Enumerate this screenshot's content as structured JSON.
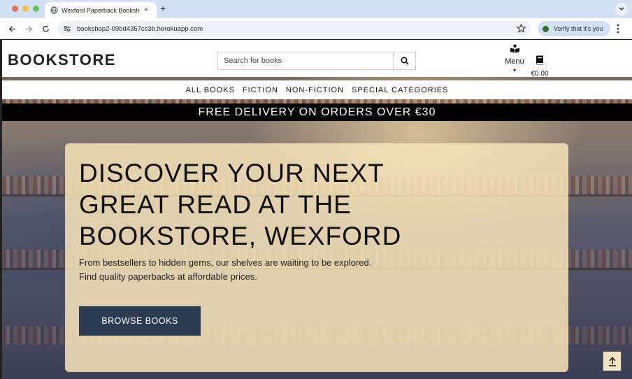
{
  "browser": {
    "tab_title": "Wexford Paperback Bookshop",
    "tab_close": "×",
    "new_tab": "+",
    "url": "bookshop2-09bd4357cc3b.herokuapp.com",
    "verify_label": "Verify that it's you",
    "icons": [
      "globe-icon",
      "back-icon",
      "forward-icon",
      "reload-icon",
      "site-info-icon",
      "star-icon",
      "kebab-icon",
      "chevron-down-icon"
    ]
  },
  "header": {
    "logo": "BOOKSTORE",
    "search_placeholder": "Search for books",
    "menu_label": "Menu",
    "menu_caret": "▾",
    "cart_amount": "€0.00"
  },
  "nav": {
    "items": [
      "ALL BOOKS",
      "FICTION",
      "NON-FICTION",
      "SPECIAL CATEGORIES"
    ]
  },
  "banner": {
    "text": "FREE DELIVERY ON ORDERS OVER €30"
  },
  "hero": {
    "headline": "DISCOVER YOUR NEXT GREAT READ AT THE BOOKSTORE, WEXFORD",
    "subtext_line1": "From bestsellers to hidden gems, our shelves are waiting to be explored.",
    "subtext_line2": "Find quality paperbacks at affordable prices.",
    "button_label": "BROWSE BOOKS"
  },
  "colors": {
    "chrome_tab_strip": "#d4e1f5",
    "banner": "#000000",
    "button": "#2a3b52",
    "card": "#f8e4b9"
  }
}
